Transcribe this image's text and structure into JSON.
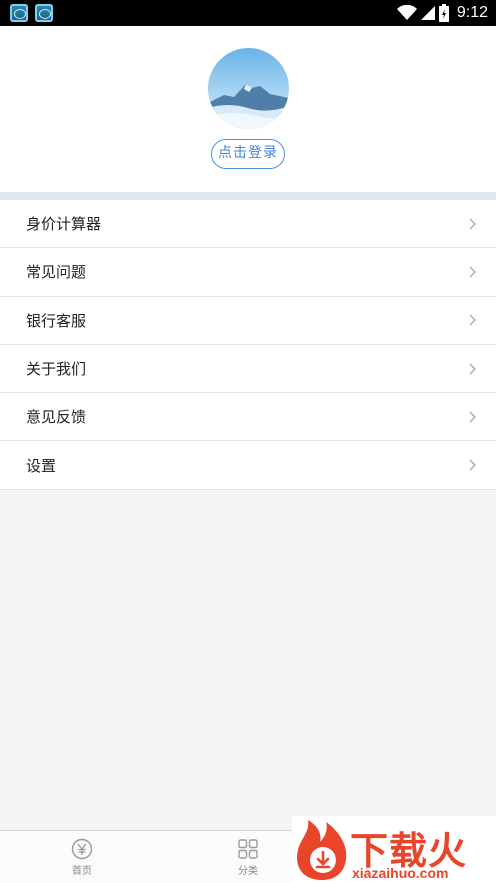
{
  "status_bar": {
    "time": "9:12",
    "icons": [
      "app-icon",
      "app-icon",
      "wifi-icon",
      "signal-icon",
      "battery-icon"
    ]
  },
  "header": {
    "login_label": "点击登录"
  },
  "menu": {
    "items": [
      {
        "label": "身价计算器"
      },
      {
        "label": "常见问题"
      },
      {
        "label": "银行客服"
      },
      {
        "label": "关于我们"
      },
      {
        "label": "意见反馈"
      },
      {
        "label": "设置"
      }
    ]
  },
  "bottom_nav": {
    "items": [
      {
        "label": "首页",
        "icon": "yen-circle-icon"
      },
      {
        "label": "分类",
        "icon": "grid-icon"
      }
    ]
  },
  "watermark": {
    "title": "下载火",
    "url": "xiazaihuo.com"
  },
  "colors": {
    "accent": "#4a90e2",
    "watermark": "#e8452a",
    "background": "#f4f4f6"
  }
}
